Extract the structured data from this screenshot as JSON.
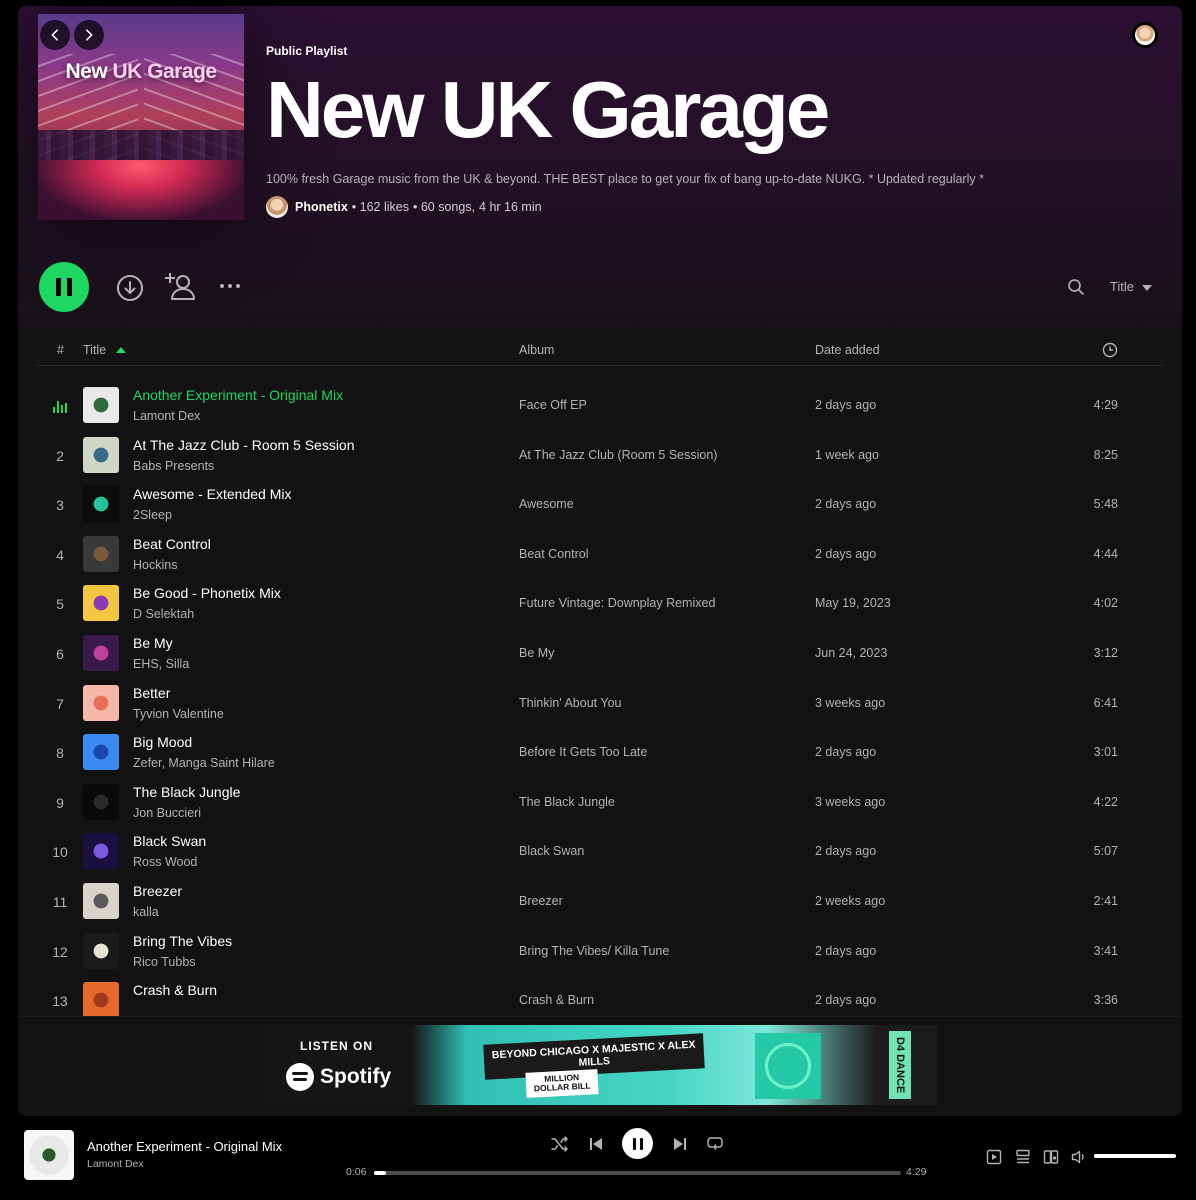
{
  "header": {
    "type_label": "Public Playlist",
    "title": "New UK Garage",
    "description": "100% fresh Garage music from the UK & beyond. THE BEST place to get your fix of bang up-to-date NUKG. * Updated regularly *",
    "owner": "Phonetix",
    "likes": "• 162 likes",
    "songs": "• 60 songs,",
    "duration": "4 hr 16 min",
    "cover": {
      "title_prefix": "New ",
      "title_highlight": "UK Garage"
    }
  },
  "actions": {
    "sort_label": "Title"
  },
  "table": {
    "col_num": "#",
    "col_title": "Title",
    "col_album": "Album",
    "col_date": "Date added"
  },
  "tracks": [
    {
      "num": "1",
      "title": "Another Experiment - Original Mix",
      "artist": "Lamont Dex",
      "album": "Face Off EP",
      "date": "2 days ago",
      "duration": "4:29",
      "playing": true,
      "art": [
        "#e9e9e9",
        "#2f6b3a"
      ]
    },
    {
      "num": "2",
      "title": "At The Jazz Club - Room 5 Session",
      "artist": "Babs Presents",
      "album": "At The Jazz Club (Room 5 Session)",
      "date": "1 week ago",
      "duration": "8:25",
      "art": [
        "#cfd6c4",
        "#3b6a8a"
      ]
    },
    {
      "num": "3",
      "title": "Awesome - Extended Mix",
      "artist": "2Sleep",
      "album": "Awesome",
      "date": "2 days ago",
      "duration": "5:48",
      "art": [
        "#0b0b0b",
        "#27c2a0"
      ]
    },
    {
      "num": "4",
      "title": "Beat Control",
      "artist": "Hockins",
      "album": "Beat Control",
      "date": "2 days ago",
      "duration": "4:44",
      "art": [
        "#3a3a3a",
        "#7a5a3a"
      ]
    },
    {
      "num": "5",
      "title": "Be Good - Phonetix Mix",
      "artist": "D Selektah",
      "album": "Future Vintage: Downplay Remixed",
      "date": "May 19, 2023",
      "duration": "4:02",
      "art": [
        "#f2c640",
        "#8a3ab8"
      ]
    },
    {
      "num": "6",
      "title": "Be My",
      "artist": "EHS, Silla",
      "album": "Be My",
      "date": "Jun 24, 2023",
      "duration": "3:12",
      "art": [
        "#3a1a4a",
        "#c040a0"
      ]
    },
    {
      "num": "7",
      "title": "Better",
      "artist": "Tyvion Valentine",
      "album": "Thinkin' About You",
      "date": "3 weeks ago",
      "duration": "6:41",
      "art": [
        "#f5b8a8",
        "#e8705a"
      ]
    },
    {
      "num": "8",
      "title": "Big Mood",
      "artist": "Zefer, Manga Saint Hilare",
      "album": "Before It Gets Too Late",
      "date": "2 days ago",
      "duration": "3:01",
      "art": [
        "#3a8af0",
        "#1a4ab0"
      ]
    },
    {
      "num": "9",
      "title": "The Black Jungle",
      "artist": "Jon Buccieri",
      "album": "The Black Jungle",
      "date": "3 weeks ago",
      "duration": "4:22",
      "art": [
        "#0a0a0a",
        "#2a2a2a"
      ]
    },
    {
      "num": "10",
      "title": "Black Swan",
      "artist": "Ross Wood",
      "album": "Black Swan",
      "date": "2 days ago",
      "duration": "5:07",
      "art": [
        "#1a1040",
        "#7a5ae0"
      ]
    },
    {
      "num": "11",
      "title": "Breezer",
      "artist": "kalla",
      "album": "Breezer",
      "date": "2 weeks ago",
      "duration": "2:41",
      "art": [
        "#d8d4cc",
        "#5a5a5a"
      ]
    },
    {
      "num": "12",
      "title": "Bring The Vibes",
      "artist": "Rico Tubbs",
      "album": "Bring The Vibes/ Killa Tune",
      "date": "2 days ago",
      "duration": "3:41",
      "art": [
        "#1a1a1a",
        "#e8e0d0"
      ]
    },
    {
      "num": "13",
      "title": "Crash & Burn",
      "artist": "",
      "album": "Crash & Burn",
      "date": "2 days ago",
      "duration": "3:36",
      "art": [
        "#e86a2a",
        "#a03a1a"
      ]
    }
  ],
  "ad": {
    "listen_on": "LISTEN ON",
    "spotify": "Spotify",
    "headline": "BEYOND CHICAGO X MAJESTIC X ALEX MILLS",
    "tag": "MILLION DOLLAR BILL",
    "brand": "D4 DANCE"
  },
  "player": {
    "title": "Another Experiment - Original Mix",
    "artist": "Lamont Dex",
    "elapsed": "0:06",
    "total": "4:29",
    "progress": 0.022,
    "volume": 1.0
  },
  "colors": {
    "accent": "#1ed760",
    "bg": "#121212",
    "header_tint": "#2c0f33"
  }
}
